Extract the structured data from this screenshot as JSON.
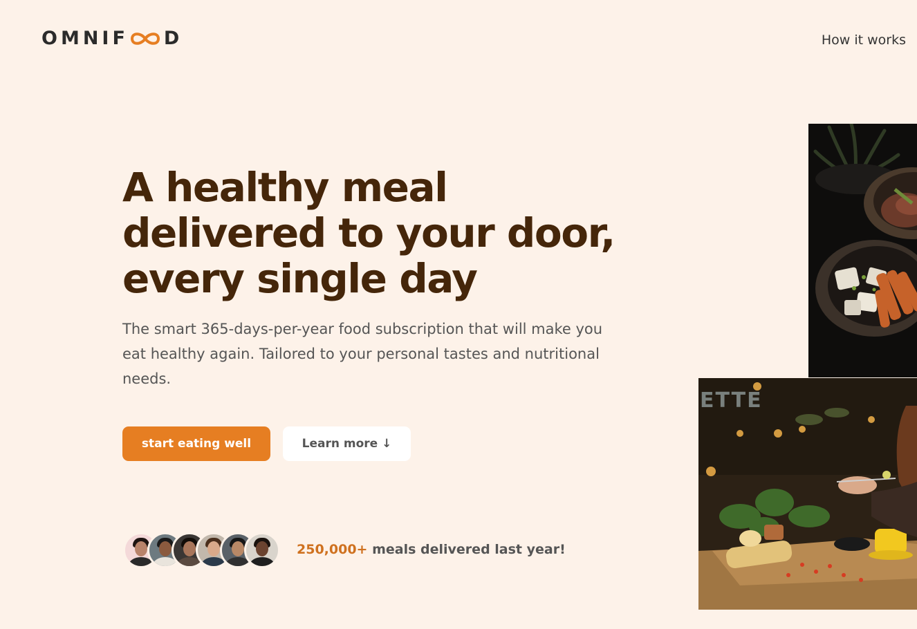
{
  "brand": {
    "name_before": "OMNIF",
    "name_after": "D",
    "accent": "#e67e22",
    "logo_icon": "infinity-icon"
  },
  "nav": {
    "items": [
      {
        "label": "How it works"
      }
    ]
  },
  "hero": {
    "title_line1": "A healthy meal",
    "title_line2": "delivered to your door,",
    "title_line3": "every single day",
    "description": "The smart 365-days-per-year food subscription that will make you eat healthy again. Tailored to your personal tastes and nutritional needs.",
    "primary_cta": "start eating well",
    "secondary_cta": "Learn more ↓"
  },
  "delivered": {
    "count": "250,000+",
    "text": " meals delivered last year!",
    "customers": [
      {
        "name": "customer-1"
      },
      {
        "name": "customer-2"
      },
      {
        "name": "customer-3"
      },
      {
        "name": "customer-4"
      },
      {
        "name": "customer-5"
      },
      {
        "name": "customer-6"
      }
    ]
  },
  "colors": {
    "background": "#fdf2e9",
    "title": "#45260a",
    "count": "#cf711f"
  }
}
